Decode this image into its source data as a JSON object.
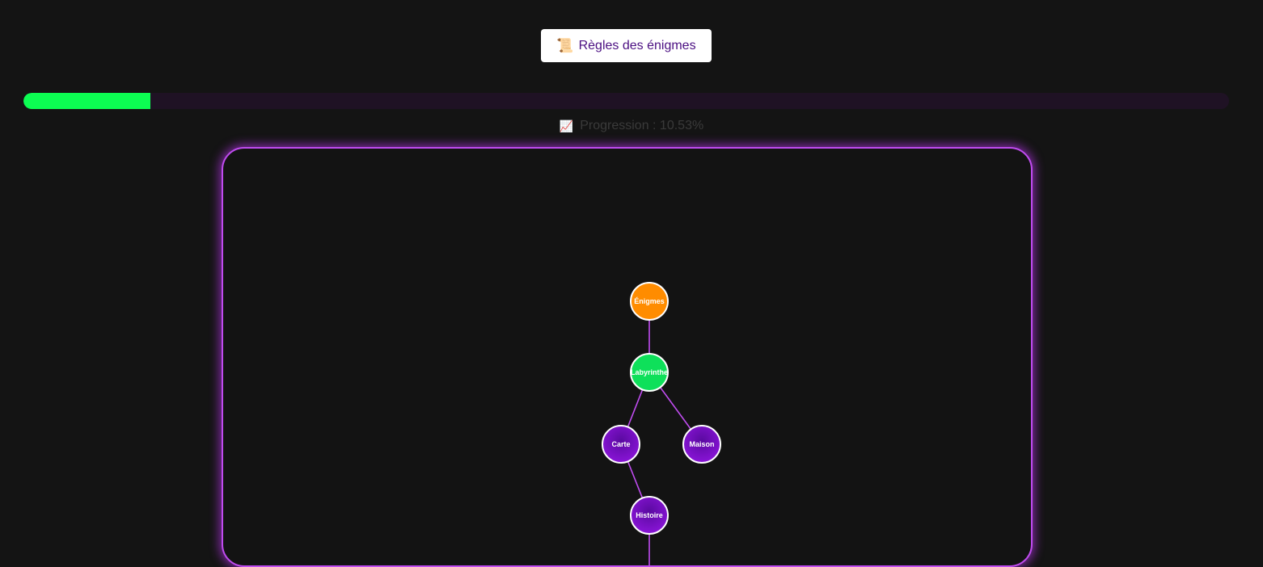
{
  "header": {
    "rules_icon": "📜",
    "rules_icon_name": "scroll-icon",
    "rules_label": "Règles des énigmes"
  },
  "progress": {
    "value_percent": 10.53,
    "icon": "📈",
    "icon_name": "chart-increasing-icon",
    "text": "Progression : 10.53%",
    "fill_color": "#0cfd52",
    "track_color": "#1f1224"
  },
  "tree": {
    "accent_color": "#c04cf0",
    "nodes": [
      {
        "id": "enigmes",
        "label": "Énigmes",
        "status": "root",
        "color": "#ff8c00"
      },
      {
        "id": "labyrinthe",
        "label": "Labyrinthe",
        "status": "solved",
        "color": "#0ee05a"
      },
      {
        "id": "carte",
        "label": "Carte",
        "status": "locked",
        "color": "#7d0fcf"
      },
      {
        "id": "maison",
        "label": "Maison",
        "status": "locked",
        "color": "#7d0fcf"
      },
      {
        "id": "histoire",
        "label": "Histoire",
        "status": "locked",
        "color": "#7d0fcf"
      }
    ],
    "edges": [
      [
        "enigmes",
        "labyrinthe"
      ],
      [
        "labyrinthe",
        "carte"
      ],
      [
        "labyrinthe",
        "maison"
      ],
      [
        "carte",
        "histoire"
      ]
    ]
  }
}
